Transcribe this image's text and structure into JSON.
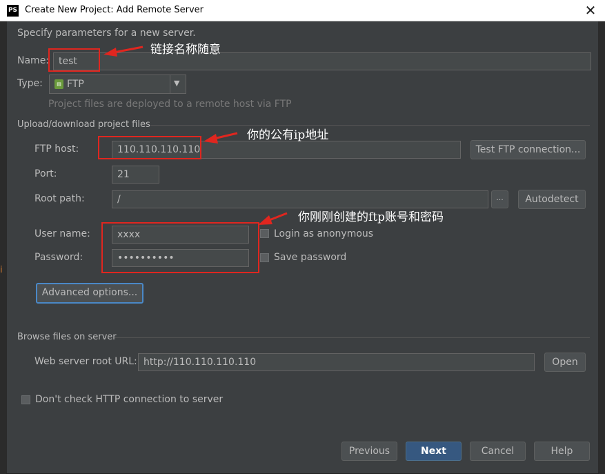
{
  "window": {
    "title": "Create New Project: Add Remote Server",
    "app_icon_text": "PS"
  },
  "intro": "Specify parameters for a new server.",
  "name": {
    "label": "Name:",
    "value": "test"
  },
  "type": {
    "label": "Type:",
    "value": "FTP",
    "hint": "Project files are deployed to a remote host via FTP"
  },
  "upload_section": "Upload/download project files",
  "ftp_host": {
    "label": "FTP host:",
    "value": "110.110.110.110",
    "test_button": "Test FTP connection..."
  },
  "port": {
    "label": "Port:",
    "value": "21"
  },
  "root_path": {
    "label": "Root path:",
    "value": "/",
    "browse_button": "...",
    "autodetect_button": "Autodetect"
  },
  "user_name": {
    "label": "User name:",
    "value": "xxxx",
    "anonymous_label": "Login as anonymous"
  },
  "password": {
    "label": "Password:",
    "value": "••••••••••",
    "save_label": "Save password"
  },
  "advanced_button": "Advanced options...",
  "browse_section": "Browse files on server",
  "web_root": {
    "label": "Web server root URL:",
    "value": "http://110.110.110.110",
    "open_button": "Open"
  },
  "dont_check_label": "Don't check HTTP connection to server",
  "footer": {
    "previous": "Previous",
    "next": "Next",
    "cancel": "Cancel",
    "help": "Help"
  },
  "annotations": {
    "name_note": "链接名称随意",
    "host_note": "你的公有ip地址",
    "account_note": "你刚刚创建的ftp账号和密码"
  },
  "side_mark": "i",
  "colors": {
    "annotation_red": "#e0261f",
    "background": "#3c3f41",
    "default_button": "#365880"
  }
}
